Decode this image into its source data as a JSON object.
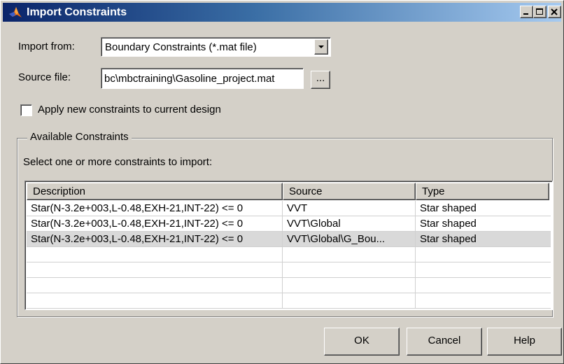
{
  "window": {
    "title": "Import Constraints"
  },
  "form": {
    "import_from_label": "Import from:",
    "import_from_value": "Boundary Constraints (*.mat file)",
    "source_file_label": "Source file:",
    "source_file_value": "bc\\mbctraining\\Gasoline_project.mat",
    "browse_label": "...",
    "apply_checkbox_label": "Apply new constraints to current design",
    "apply_checked": false
  },
  "available": {
    "group_title": "Available Constraints",
    "instruction": "Select one or more constraints to import:",
    "columns": [
      "Description",
      "Source",
      "Type"
    ],
    "rows": [
      {
        "description": "Star(N-3.2e+003,L-0.48,EXH-21,INT-22) <= 0",
        "source": "VVT",
        "type": "Star shaped"
      },
      {
        "description": "Star(N-3.2e+003,L-0.48,EXH-21,INT-22) <= 0",
        "source": "VVT\\Global",
        "type": "Star shaped"
      },
      {
        "description": "Star(N-3.2e+003,L-0.48,EXH-21,INT-22) <= 0",
        "source": "VVT\\Global\\G_Bou...",
        "type": "Star shaped"
      }
    ],
    "selected_row": 2
  },
  "buttons": {
    "ok": "OK",
    "cancel": "Cancel",
    "help": "Help"
  },
  "icons": {
    "app": "matlab-logo-icon",
    "minimize": "minimize-icon",
    "maximize": "maximize-icon",
    "close": "close-icon",
    "dropdown": "chevron-down-icon"
  },
  "colors": {
    "titlebar_start": "#0a246a",
    "titlebar_end": "#a6caf0",
    "face": "#d4d0c8",
    "selected_row": "#d9d9d9"
  }
}
